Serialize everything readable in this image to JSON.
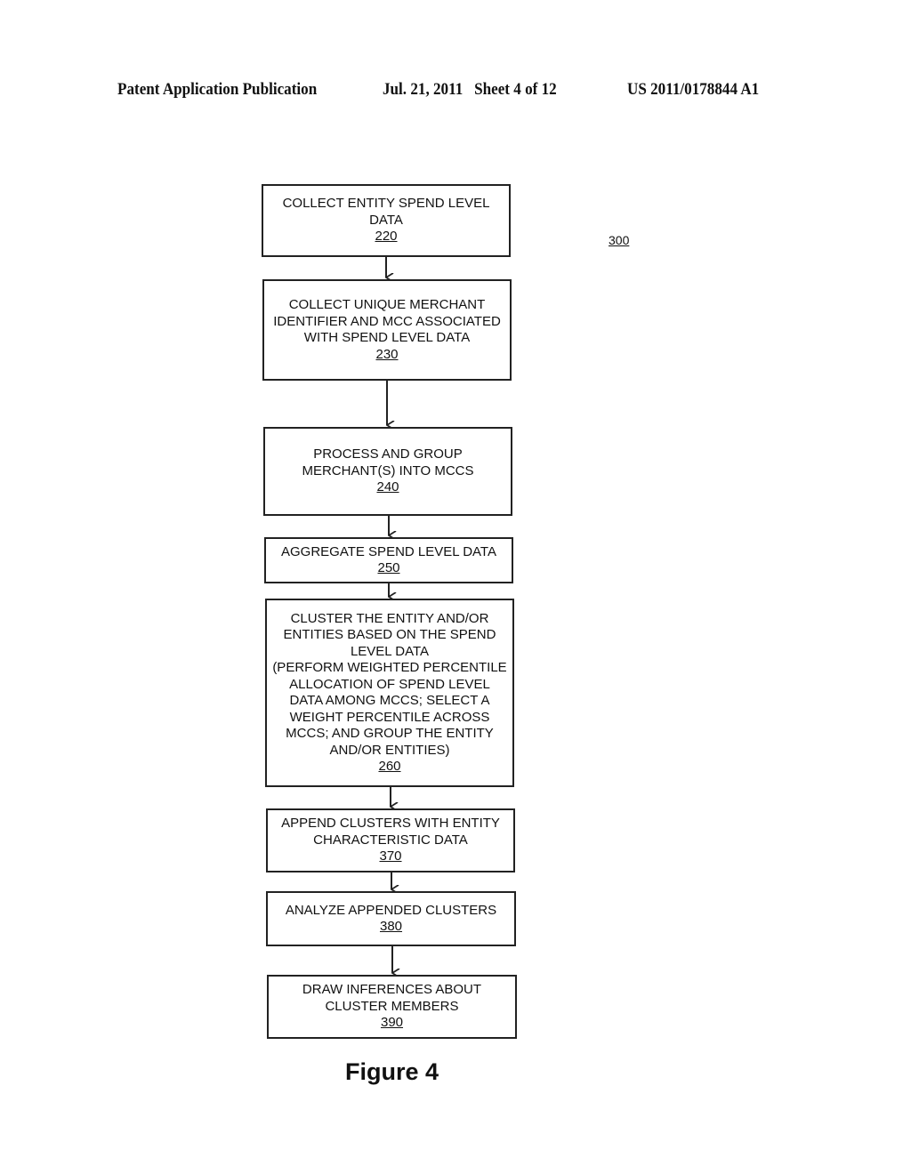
{
  "header": {
    "publication": "Patent Application Publication",
    "date_sheet": "Jul. 21, 2011   Sheet 4 of 12",
    "number": "US 2011/0178844 A1"
  },
  "diagram_ref": "300",
  "steps": [
    {
      "text": "COLLECT ENTITY SPEND LEVEL\nDATA",
      "number": "220"
    },
    {
      "text": "COLLECT UNIQUE MERCHANT\nIDENTIFIER AND MCC ASSOCIATED\nWITH SPEND LEVEL DATA",
      "number": "230"
    },
    {
      "text": "PROCESS AND GROUP\nMERCHANT(S) INTO MCCS",
      "number": "240"
    },
    {
      "text": "AGGREGATE SPEND LEVEL DATA",
      "number": "250"
    },
    {
      "text": "CLUSTER THE ENTITY AND/OR\nENTITIES BASED ON THE SPEND\nLEVEL DATA\n(PERFORM WEIGHTED PERCENTILE\nALLOCATION OF SPEND LEVEL\nDATA AMONG MCCS; SELECT A\nWEIGHT PERCENTILE ACROSS\nMCCS; AND GROUP THE ENTITY\nAND/OR ENTITIES)",
      "number": "260"
    },
    {
      "text": "APPEND CLUSTERS WITH ENTITY\nCHARACTERISTIC DATA",
      "number": "370"
    },
    {
      "text": "ANALYZE APPENDED CLUSTERS",
      "number": "380"
    },
    {
      "text": "DRAW INFERENCES ABOUT\nCLUSTER MEMBERS",
      "number": "390"
    }
  ],
  "figure_caption": "Figure 4"
}
